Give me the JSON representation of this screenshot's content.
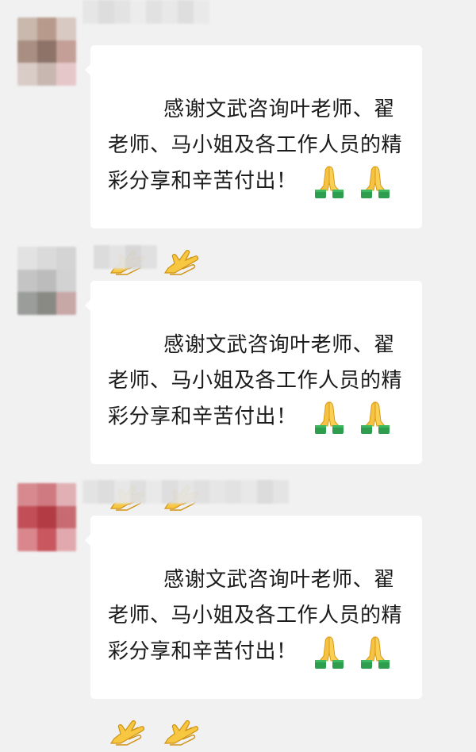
{
  "messages": [
    {
      "avatar_colors": [
        "#c9b8ad",
        "#b89a8c",
        "#d8c9c2",
        "#a88f82",
        "#8d7368",
        "#c39f97",
        "#d9ccc7",
        "#c8b7b1",
        "#e6c7c9"
      ],
      "name_colors": [
        "#e6e6e6",
        "#dcdcdc",
        "#e3e3e3",
        "#ececec",
        "#e1e1e1",
        "#e8e8e8",
        "#dedede",
        "#e9e9e9"
      ],
      "text": "感谢文武咨询叶老师、翟老师、马小姐及各工作人员的精彩分享和辛苦付出！",
      "emoji_after_text": [
        "pray-icon",
        "pray-icon"
      ],
      "emoji_line": [
        "clap-icon",
        "clap-icon"
      ]
    },
    {
      "avatar_colors": [
        "#e2e2e2",
        "#dadada",
        "#d4d4d4",
        "#c4c4c4",
        "#bcbcbc",
        "#d2d2d2",
        "#9a9d9a",
        "#8a8a84",
        "#c8a8a7"
      ],
      "name_colors": [
        "#dbdbdb",
        "#e3e3e3",
        "#d6d6d6",
        "#e0e0e0"
      ],
      "text": "感谢文武咨询叶老师、翟老师、马小姐及各工作人员的精彩分享和辛苦付出！",
      "emoji_after_text": [
        "pray-icon",
        "pray-icon"
      ],
      "emoji_line": [
        "clap-icon",
        "clap-icon"
      ]
    },
    {
      "avatar_colors": [
        "#d68a8f",
        "#cf7a80",
        "#e0b0b5",
        "#c24f58",
        "#b23b44",
        "#c76a71",
        "#d9878d",
        "#c8575f",
        "#e1a9ad"
      ],
      "name_colors": [
        "#e3e3e3",
        "#dcdcdc",
        "#e7e7e7",
        "#dfdfdf",
        "#e9e9e9",
        "#dddddd",
        "#e5e5e5",
        "#e0e0e0",
        "#e6e6e6",
        "#e2e2e2",
        "#e8e8e8",
        "#dbdbdb",
        "#e4e4e4"
      ],
      "text": "感谢文武咨询叶老师、翟老师、马小姐及各工作人员的精彩分享和辛苦付出！",
      "emoji_after_text": [
        "pray-icon",
        "pray-icon"
      ],
      "emoji_line": [
        "clap-icon",
        "clap-icon"
      ]
    }
  ]
}
